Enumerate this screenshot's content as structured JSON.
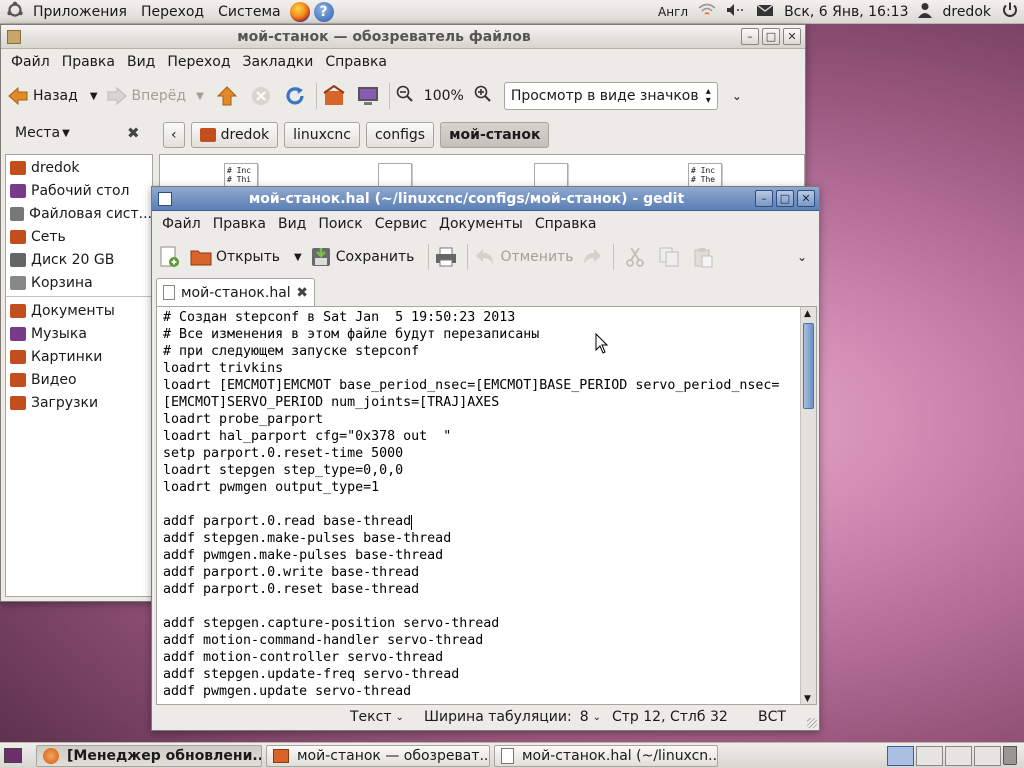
{
  "top_panel": {
    "menus": [
      "Приложения",
      "Переход",
      "Система"
    ],
    "keyboard_layout": "Англ",
    "datetime": "Вск,  6 Янв, 16:13",
    "user": "dredok"
  },
  "nautilus": {
    "title": "мой-станок — обозреватель файлов",
    "menu": [
      "Файл",
      "Правка",
      "Вид",
      "Переход",
      "Закладки",
      "Справка"
    ],
    "toolbar": {
      "back": "Назад",
      "forward": "Вперёд",
      "zoom": "100%",
      "view_mode": "Просмотр в виде значков"
    },
    "sidebar_header": "Места",
    "places": [
      {
        "label": "dredok",
        "icon": "home-folder-icon",
        "color": "#c24e1e"
      },
      {
        "label": "Рабочий стол",
        "icon": "desktop-folder-icon",
        "color": "#7a3a8c"
      },
      {
        "label": "Файловая сист...",
        "icon": "drive-icon",
        "color": "#777777"
      },
      {
        "label": "Сеть",
        "icon": "network-icon",
        "color": "#c24e1e"
      },
      {
        "label": "Диск 20 GB",
        "icon": "disk-icon",
        "color": "#666666"
      },
      {
        "label": "Корзина",
        "icon": "trash-icon",
        "color": "#888888"
      }
    ],
    "bookmarks": [
      {
        "label": "Документы",
        "icon": "documents-folder-icon",
        "color": "#c24e1e"
      },
      {
        "label": "Музыка",
        "icon": "music-folder-icon",
        "color": "#7a3a8c"
      },
      {
        "label": "Картинки",
        "icon": "pictures-folder-icon",
        "color": "#c24e1e"
      },
      {
        "label": "Видео",
        "icon": "videos-folder-icon",
        "color": "#c24e1e"
      },
      {
        "label": "Загрузки",
        "icon": "downloads-folder-icon",
        "color": "#c24e1e"
      }
    ],
    "path": [
      "dredok",
      "linuxcnc",
      "configs",
      "мой-станок"
    ],
    "file_thumbs": [
      {
        "lines": [
          "# Inc",
          "# Thi"
        ]
      },
      {
        "lines": [
          "",
          ""
        ]
      },
      {
        "lines": [
          "",
          ""
        ]
      },
      {
        "lines": [
          "# Inc",
          "# The"
        ]
      }
    ]
  },
  "gedit": {
    "title": "мой-станок.hal (~/linuxcnc/configs/мой-станок) - gedit",
    "menu": [
      "Файл",
      "Правка",
      "Вид",
      "Поиск",
      "Сервис",
      "Документы",
      "Справка"
    ],
    "toolbar": {
      "open": "Открыть",
      "save": "Сохранить",
      "undo": "Отменить"
    },
    "tab": "мой-станок.hal",
    "lines": [
      "# Создан stepconf в Sat Jan  5 19:50:23 2013",
      "# Все изменения в этом файле будут перезаписаны",
      "# при следующем запуске stepconf",
      "loadrt trivkins",
      "loadrt [EMCMOT]EMCMOT base_period_nsec=[EMCMOT]BASE_PERIOD servo_period_nsec=",
      "[EMCMOT]SERVO_PERIOD num_joints=[TRAJ]AXES",
      "loadrt probe_parport",
      "loadrt hal_parport cfg=\"0x378 out  \"",
      "setp parport.0.reset-time 5000",
      "loadrt stepgen step_type=0,0,0",
      "loadrt pwmgen output_type=1",
      "",
      "addf parport.0.read base-thread",
      "addf stepgen.make-pulses base-thread",
      "addf pwmgen.make-pulses base-thread",
      "addf parport.0.write base-thread",
      "addf parport.0.reset base-thread",
      "",
      "addf stepgen.capture-position servo-thread",
      "addf motion-command-handler servo-thread",
      "addf motion-controller servo-thread",
      "addf stepgen.update-freq servo-thread",
      "addf pwmgen.update servo-thread"
    ],
    "status": {
      "syntax": "Текст",
      "tab_width_label": "Ширина табуляции:",
      "tab_width": "8",
      "cursor": "Стр 12, Стлб 32",
      "mode": "ВСТ"
    }
  },
  "taskbar": [
    {
      "label": "[Менеджер обновлени...",
      "icon": "update-manager-icon"
    },
    {
      "label": "мой-станок — обозреват...",
      "icon": "folder-icon"
    },
    {
      "label": "мой-станок.hal (~/linuxcn...",
      "icon": "text-editor-icon"
    }
  ],
  "colors": {
    "accent": "#5c7fb5",
    "ubuntu_orange": "#dd4814"
  }
}
